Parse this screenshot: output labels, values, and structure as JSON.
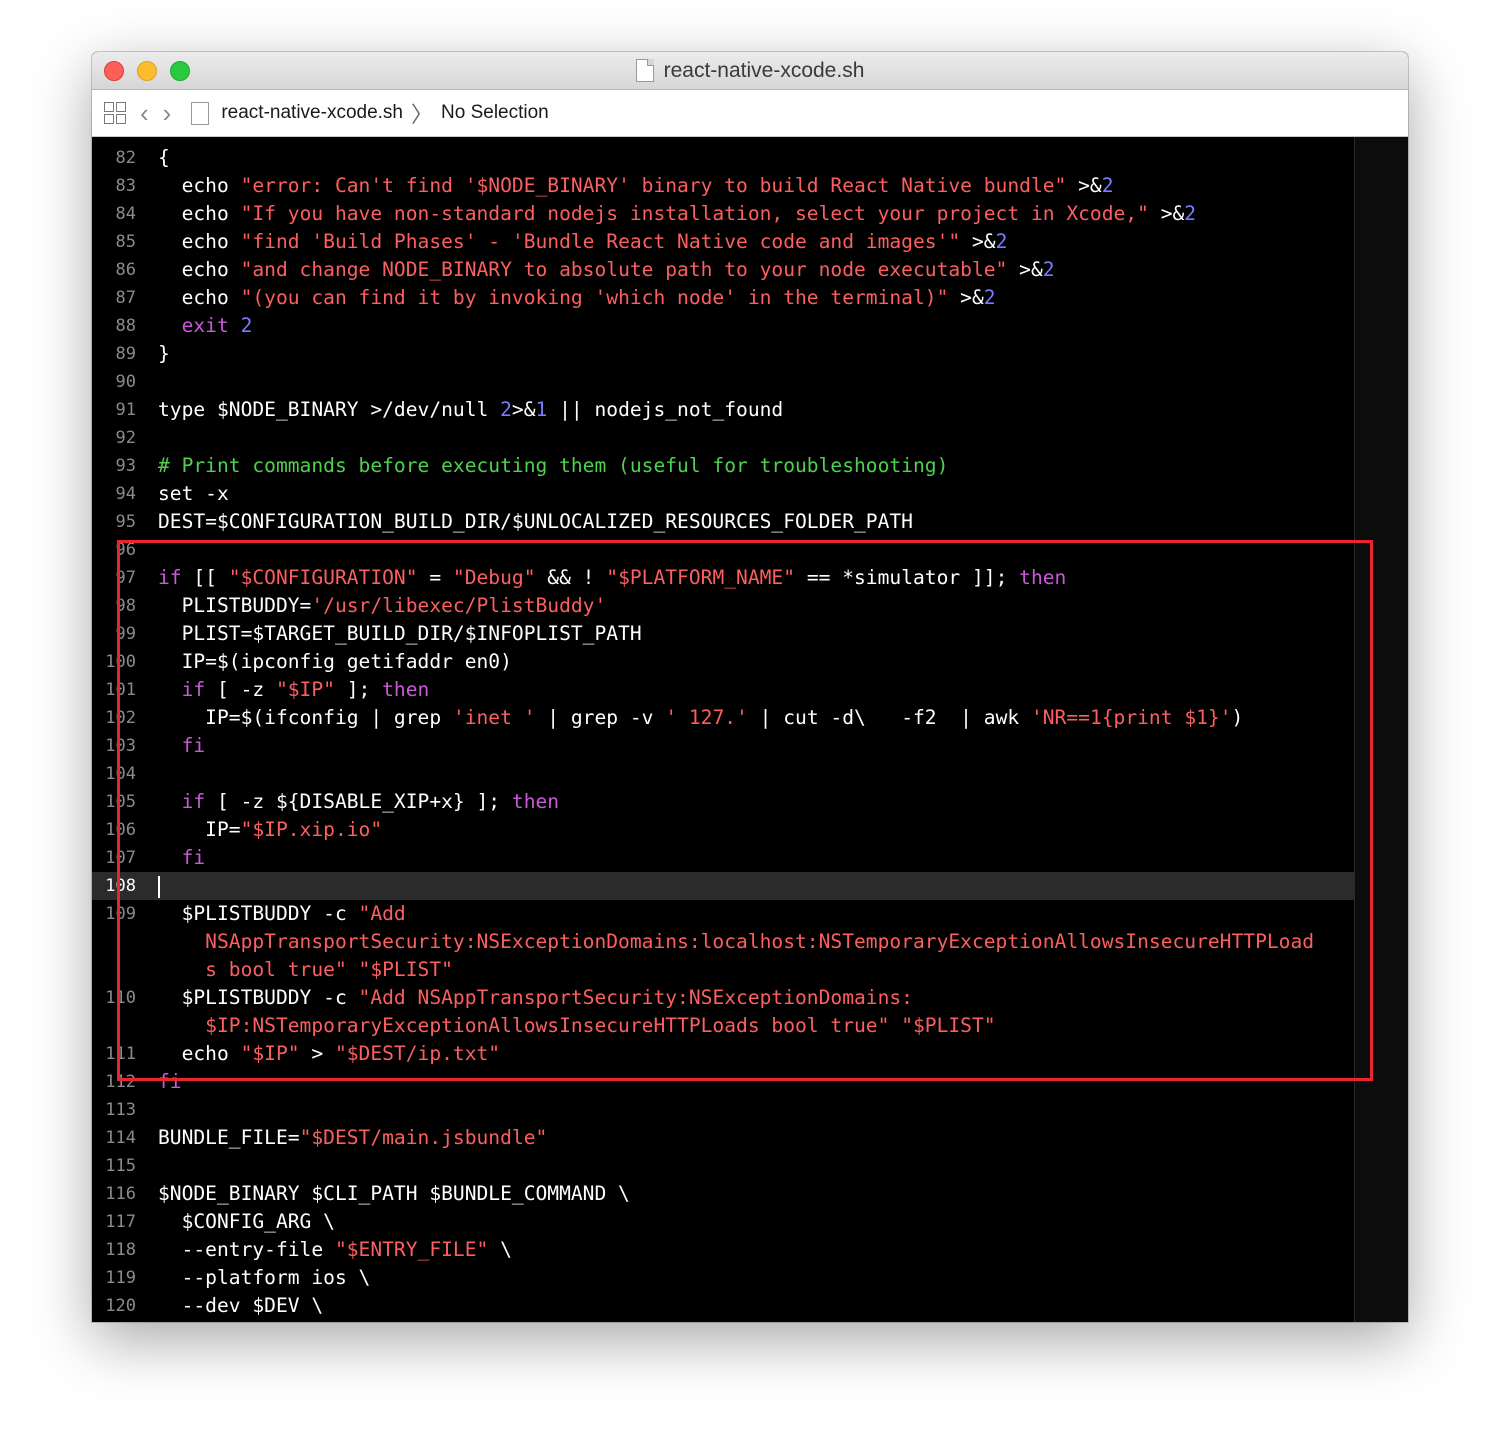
{
  "window": {
    "title": "react-native-xcode.sh"
  },
  "jumpbar": {
    "file": "react-native-xcode.sh",
    "selection": "No Selection"
  },
  "editor": {
    "current_line": "108",
    "lines": [
      {
        "n": "82",
        "tokens": [
          [
            "t",
            "{"
          ]
        ]
      },
      {
        "n": "83",
        "tokens": [
          [
            "t",
            "  echo "
          ],
          [
            "s",
            "\"error: Can't find '$NODE_BINARY' binary to build React Native bundle\""
          ],
          [
            "t",
            " >&"
          ],
          [
            "n",
            "2"
          ]
        ]
      },
      {
        "n": "84",
        "tokens": [
          [
            "t",
            "  echo "
          ],
          [
            "s",
            "\"If you have non-standard nodejs installation, select your project in Xcode,\""
          ],
          [
            "t",
            " >&"
          ],
          [
            "n",
            "2"
          ]
        ]
      },
      {
        "n": "85",
        "tokens": [
          [
            "t",
            "  echo "
          ],
          [
            "s",
            "\"find 'Build Phases' - 'Bundle React Native code and images'\""
          ],
          [
            "t",
            " >&"
          ],
          [
            "n",
            "2"
          ]
        ]
      },
      {
        "n": "86",
        "tokens": [
          [
            "t",
            "  echo "
          ],
          [
            "s",
            "\"and change NODE_BINARY to absolute path to your node executable\""
          ],
          [
            "t",
            " >&"
          ],
          [
            "n",
            "2"
          ]
        ]
      },
      {
        "n": "87",
        "tokens": [
          [
            "t",
            "  echo "
          ],
          [
            "s",
            "\"(you can find it by invoking 'which node' in the terminal)\""
          ],
          [
            "t",
            " >&"
          ],
          [
            "n",
            "2"
          ]
        ]
      },
      {
        "n": "88",
        "tokens": [
          [
            "k",
            "  exit "
          ],
          [
            "n",
            "2"
          ]
        ]
      },
      {
        "n": "89",
        "tokens": [
          [
            "t",
            "}"
          ]
        ]
      },
      {
        "n": "90",
        "tokens": []
      },
      {
        "n": "91",
        "tokens": [
          [
            "t",
            "type $NODE_BINARY >/dev/null "
          ],
          [
            "n",
            "2"
          ],
          [
            "t",
            ">&"
          ],
          [
            "n",
            "1"
          ],
          [
            "t",
            " || nodejs_not_found"
          ]
        ]
      },
      {
        "n": "92",
        "tokens": []
      },
      {
        "n": "93",
        "tokens": [
          [
            "c",
            "# Print commands before executing them (useful for troubleshooting)"
          ]
        ]
      },
      {
        "n": "94",
        "tokens": [
          [
            "t",
            "set -x"
          ]
        ]
      },
      {
        "n": "95",
        "tokens": [
          [
            "t",
            "DEST=$CONFIGURATION_BUILD_DIR/$UNLOCALIZED_RESOURCES_FOLDER_PATH"
          ]
        ]
      },
      {
        "n": "96",
        "tokens": []
      },
      {
        "n": "97",
        "tokens": [
          [
            "k",
            "if"
          ],
          [
            "t",
            " [[ "
          ],
          [
            "s",
            "\"$CONFIGURATION\""
          ],
          [
            "t",
            " = "
          ],
          [
            "s",
            "\"Debug\""
          ],
          [
            "t",
            " && ! "
          ],
          [
            "s",
            "\"$PLATFORM_NAME\""
          ],
          [
            "t",
            " == *simulator ]]; "
          ],
          [
            "k",
            "then"
          ]
        ]
      },
      {
        "n": "98",
        "tokens": [
          [
            "t",
            "  PLISTBUDDY="
          ],
          [
            "s",
            "'/usr/libexec/PlistBuddy'"
          ]
        ]
      },
      {
        "n": "99",
        "tokens": [
          [
            "t",
            "  PLIST=$TARGET_BUILD_DIR/$INFOPLIST_PATH"
          ]
        ]
      },
      {
        "n": "100",
        "tokens": [
          [
            "t",
            "  IP=$(ipconfig getifaddr en0)"
          ]
        ]
      },
      {
        "n": "101",
        "tokens": [
          [
            "k",
            "  if"
          ],
          [
            "t",
            " [ -z "
          ],
          [
            "s",
            "\"$IP\""
          ],
          [
            "t",
            " ]; "
          ],
          [
            "k",
            "then"
          ]
        ]
      },
      {
        "n": "102",
        "tokens": [
          [
            "t",
            "    IP=$(ifconfig | grep "
          ],
          [
            "s",
            "'inet '"
          ],
          [
            "t",
            " | grep -v "
          ],
          [
            "s",
            "' 127.'"
          ],
          [
            "t",
            " | cut -d\\   -f2  | awk "
          ],
          [
            "s",
            "'NR==1{print $1}'"
          ],
          [
            "t",
            ")"
          ]
        ]
      },
      {
        "n": "103",
        "tokens": [
          [
            "k",
            "  fi"
          ]
        ]
      },
      {
        "n": "104",
        "tokens": []
      },
      {
        "n": "105",
        "tokens": [
          [
            "k",
            "  if"
          ],
          [
            "t",
            " [ -z ${DISABLE_XIP+x} ]; "
          ],
          [
            "k",
            "then"
          ]
        ]
      },
      {
        "n": "106",
        "tokens": [
          [
            "t",
            "    IP="
          ],
          [
            "s",
            "\"$IP.xip.io\""
          ]
        ]
      },
      {
        "n": "107",
        "tokens": [
          [
            "k",
            "  fi"
          ]
        ]
      },
      {
        "n": "108",
        "tokens": [],
        "cursor": true
      },
      {
        "n": "109",
        "tokens": [
          [
            "t",
            "  $PLISTBUDDY -c "
          ],
          [
            "s",
            "\"Add"
          ]
        ]
      },
      {
        "n": "",
        "tokens": [
          [
            "s",
            "    NSAppTransportSecurity:NSExceptionDomains:localhost:NSTemporaryExceptionAllowsInsecureHTTPLoad"
          ]
        ]
      },
      {
        "n": "",
        "tokens": [
          [
            "s",
            "    s bool true\""
          ],
          [
            "t",
            " "
          ],
          [
            "s",
            "\"$PLIST\""
          ]
        ]
      },
      {
        "n": "110",
        "tokens": [
          [
            "t",
            "  $PLISTBUDDY -c "
          ],
          [
            "s",
            "\"Add NSAppTransportSecurity:NSExceptionDomains:"
          ]
        ]
      },
      {
        "n": "",
        "tokens": [
          [
            "s",
            "    $IP:NSTemporaryExceptionAllowsInsecureHTTPLoads bool true\""
          ],
          [
            "t",
            " "
          ],
          [
            "s",
            "\"$PLIST\""
          ]
        ]
      },
      {
        "n": "111",
        "tokens": [
          [
            "t",
            "  echo "
          ],
          [
            "s",
            "\"$IP\""
          ],
          [
            "t",
            " > "
          ],
          [
            "s",
            "\"$DEST/ip.txt\""
          ]
        ]
      },
      {
        "n": "112",
        "tokens": [
          [
            "k",
            "fi"
          ]
        ]
      },
      {
        "n": "113",
        "tokens": []
      },
      {
        "n": "114",
        "tokens": [
          [
            "t",
            "BUNDLE_FILE="
          ],
          [
            "s",
            "\"$DEST/main.jsbundle\""
          ]
        ]
      },
      {
        "n": "115",
        "tokens": []
      },
      {
        "n": "116",
        "tokens": [
          [
            "t",
            "$NODE_BINARY $CLI_PATH $BUNDLE_COMMAND \\"
          ]
        ]
      },
      {
        "n": "117",
        "tokens": [
          [
            "t",
            "  $CONFIG_ARG \\"
          ]
        ]
      },
      {
        "n": "118",
        "tokens": [
          [
            "t",
            "  --entry-file "
          ],
          [
            "s",
            "\"$ENTRY_FILE\""
          ],
          [
            "t",
            " \\"
          ]
        ]
      },
      {
        "n": "119",
        "tokens": [
          [
            "t",
            "  --platform ios \\"
          ]
        ]
      },
      {
        "n": "120",
        "tokens": [
          [
            "t",
            "  --dev $DEV \\"
          ]
        ]
      }
    ]
  },
  "colors": {
    "string": "#fc5f5f",
    "keyword": "#c75bd6",
    "number": "#7a7bff",
    "comment": "#4fd14f",
    "highlight_box": "#e8262c"
  },
  "icons": [
    "related-items-grid-icon",
    "back-arrow-icon",
    "forward-arrow-icon",
    "document-icon"
  ]
}
